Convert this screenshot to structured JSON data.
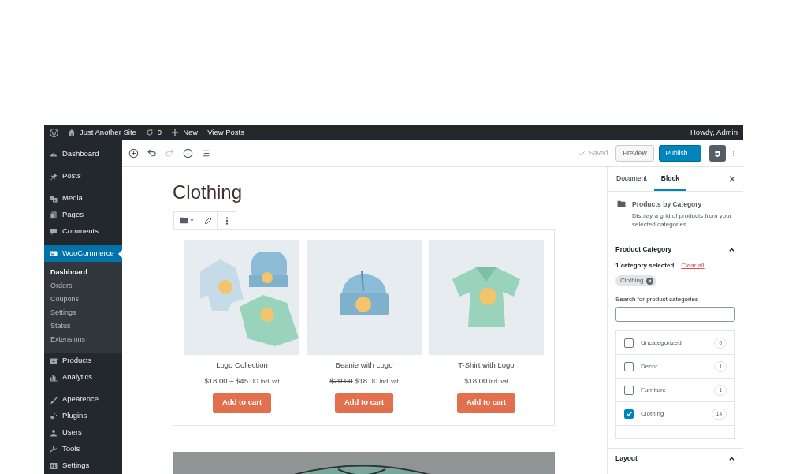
{
  "admin_bar": {
    "site": "Just Another Site",
    "updates": "0",
    "new": "New",
    "view": "View Posts",
    "greeting": "Howdy, Admin"
  },
  "sidebar": {
    "groups": [
      [
        {
          "label": "Dashboard",
          "selected": false
        }
      ],
      [
        {
          "label": "Posts",
          "selected": false
        }
      ],
      [
        {
          "label": "Media",
          "selected": false
        },
        {
          "label": "Pages",
          "selected": false
        },
        {
          "label": "Comments",
          "selected": false
        }
      ],
      [
        {
          "label": "WooCommerce",
          "selected": true,
          "children": [
            {
              "label": "Dashboard",
              "selected": true
            },
            {
              "label": "Orders",
              "selected": false
            },
            {
              "label": "Coupons",
              "selected": false
            },
            {
              "label": "Settings",
              "selected": false
            },
            {
              "label": "Status",
              "selected": false
            },
            {
              "label": "Extensions",
              "selected": false
            }
          ]
        },
        {
          "label": "Products",
          "selected": false
        },
        {
          "label": "Analytics",
          "selected": false
        }
      ],
      [
        {
          "label": "Apearence",
          "selected": false
        },
        {
          "label": "Plugins",
          "selected": false
        },
        {
          "label": "Users",
          "selected": false
        },
        {
          "label": "Tools",
          "selected": false
        },
        {
          "label": "Settings",
          "selected": false
        }
      ]
    ]
  },
  "toolbar": {
    "redo_disabled": true,
    "status": "Saved",
    "preview": "Preview",
    "publish": "Publish…",
    "settings_open": true
  },
  "post": {
    "title": "Clothing"
  },
  "products": [
    {
      "name": "Logo Collection",
      "price": "$18.00 – $45.00",
      "tax": "incl. vat",
      "button": "Add to cart"
    },
    {
      "name": "Beanie with Logo",
      "old_price": "$20.00",
      "price": "$18.00",
      "tax": "incl. vat",
      "button": "Add to cart"
    },
    {
      "name": "T-Shirt with Logo",
      "price": "$18.00",
      "tax": "incl. vat",
      "button": "Add to cart"
    }
  ],
  "settings_panel": {
    "tabs": [
      {
        "label": "Document",
        "selected": false
      },
      {
        "label": "Block",
        "selected": true
      }
    ],
    "block": {
      "title": "Products by Category",
      "description": "Display a grid of products from your selected categories."
    },
    "product_category": {
      "title": "Product Category",
      "expanded": true,
      "summary": "1 category selected",
      "clear": "Clear all",
      "chips": [
        "Clothing"
      ],
      "search_label": "Search for product categories",
      "categories": [
        {
          "name": "Uncategorized",
          "count": "0",
          "checked": false
        },
        {
          "name": "Decor",
          "count": "1",
          "checked": false
        },
        {
          "name": "Furniture",
          "count": "1",
          "checked": false
        },
        {
          "name": "Clothing",
          "count": "14",
          "checked": true
        }
      ]
    },
    "layout": {
      "title": "Layout",
      "expanded": true
    }
  }
}
